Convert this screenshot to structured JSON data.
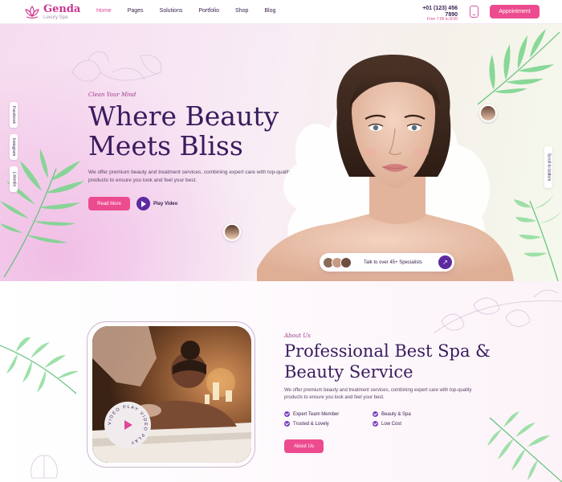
{
  "header": {
    "logo_name": "Genda",
    "logo_sub": "Luxury Spa",
    "nav": [
      "Home",
      "Pages",
      "Solutions",
      "Portfolio",
      "Shop",
      "Blog"
    ],
    "active_nav": "Home",
    "phone": "+01 (123) 456 7890",
    "phone_alt": "Free 7:00 to 8:00",
    "appointment_label": "Appointment"
  },
  "social": [
    "Facebook",
    "Instagram",
    "Linkedin"
  ],
  "scroll_label": "Scroll to bottom",
  "hero": {
    "eyebrow": "Clean Your Mind",
    "title": "Where Beauty Meets Bliss",
    "description": "We offer premium beauty and treatment services, combining expert care with top-quality products to ensure you look and feel your best.",
    "read_more_label": "Read More",
    "play_video_label": "Play Video",
    "specialists_text": "Talk to over 45+ Specialists"
  },
  "about": {
    "eyebrow": "About Us",
    "title": "Professional Best Spa & Beauty Service",
    "description": "We offer premium beauty and treatment services, combining expert care with top-quality products to ensure you look and feel your best.",
    "features": [
      "Expert Team Member",
      "Beauty & Spa",
      "Trusted & Lovely",
      "Low Cost"
    ],
    "button_label": "About Us",
    "video_badge_text": "VIDEO PLAY VIDEO PLAY"
  },
  "colors": {
    "primary_pink": "#ec4c8f",
    "deep_purple": "#3a1b5e",
    "accent_purple": "#5d2aa0"
  },
  "icons": [
    "lotus-logo-icon",
    "phone-icon",
    "play-icon",
    "arrow-up-right-icon",
    "check-icon",
    "palm-leaf-icon"
  ]
}
